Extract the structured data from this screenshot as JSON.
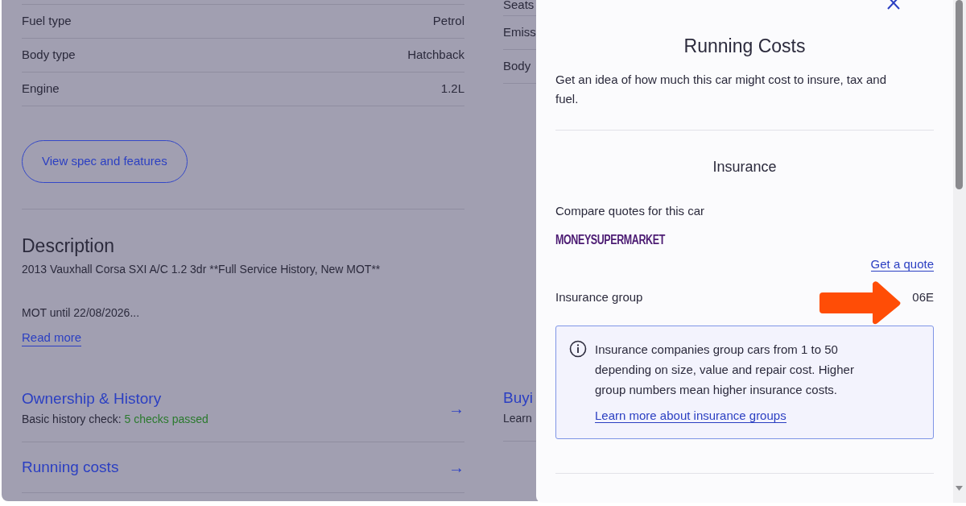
{
  "spec_table": {
    "rows": [
      {
        "label": "Fuel type",
        "value": "Petrol"
      },
      {
        "label": "Body type",
        "value": "Hatchback"
      },
      {
        "label": "Engine",
        "value": "1.2L"
      }
    ]
  },
  "side_spec_labels": [
    "Seats",
    "Emiss",
    "Body"
  ],
  "spec_button": "View spec and features",
  "description": {
    "heading": "Description",
    "lines": [
      "2013 Vauxhall Corsa SXI A/C 1.2 3dr **Full Service History, New MOT**",
      "MOT until 22/08/2026..."
    ],
    "read_more": "Read more"
  },
  "sections": [
    {
      "title": "Ownership & History",
      "subtitle": "Basic history check: ",
      "highlight": "5 checks passed",
      "arrow": "→"
    },
    {
      "title": "Running costs",
      "arrow": "→"
    }
  ],
  "side_section": {
    "title": "Buyi",
    "subtitle": "Learn"
  },
  "panel": {
    "title": "Running Costs",
    "intro": "Get an idea of how much this car might cost to insure, tax and fuel.",
    "insurance": {
      "heading": "Insurance",
      "compare": "Compare quotes for this car",
      "provider_logo": "MONEYSUPERMARKET",
      "quote_link": "Get a quote",
      "group_label": "Insurance group",
      "group_value": "06E",
      "info": {
        "text": "Insurance companies group cars from 1 to 50 depending on size, value and repair cost. Higher group numbers mean higher insurance costs.",
        "link": "Learn more about insurance groups"
      }
    }
  }
}
